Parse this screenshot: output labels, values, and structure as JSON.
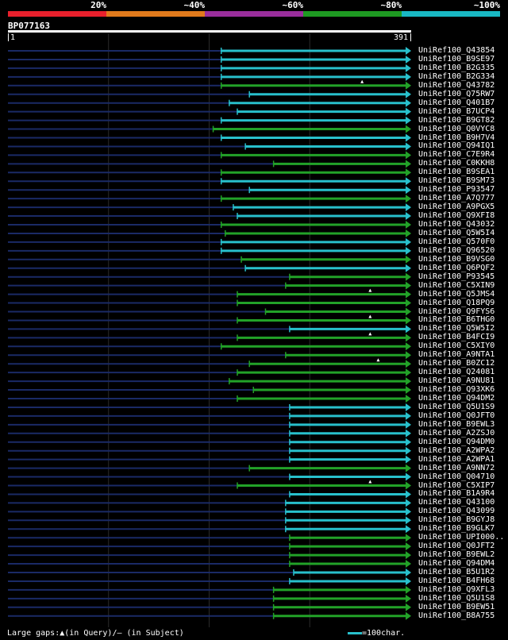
{
  "legend": {
    "labels": [
      "20%",
      "~40%",
      "~60%",
      "~80%",
      "~100%"
    ],
    "colors": [
      "#e8202c",
      "#e07a1c",
      "#9a2e9c",
      "#1e9a22",
      "#19b8c4"
    ]
  },
  "query": {
    "name": "BP077163",
    "start": "1",
    "end": "391"
  },
  "footer": {
    "gaps_text": "Large gaps:▲(in Query)/– (in Subject)",
    "scale_text": "=100char."
  },
  "hits": [
    {
      "id": "UniRef100_Q43854",
      "start": 0.53,
      "color": "cyan"
    },
    {
      "id": "UniRef100_B9SE97",
      "start": 0.53,
      "color": "cyan"
    },
    {
      "id": "UniRef100_B2G335",
      "start": 0.53,
      "color": "cyan"
    },
    {
      "id": "UniRef100_B2G334",
      "start": 0.53,
      "color": "cyan"
    },
    {
      "id": "UniRef100_Q43782",
      "start": 0.53,
      "color": "green",
      "gap": 0.88
    },
    {
      "id": "UniRef100_Q75RW7",
      "start": 0.6,
      "color": "cyan"
    },
    {
      "id": "UniRef100_Q401B7",
      "start": 0.55,
      "color": "cyan"
    },
    {
      "id": "UniRef100_B7UCP4",
      "start": 0.57,
      "color": "cyan"
    },
    {
      "id": "UniRef100_B9GT82",
      "start": 0.53,
      "color": "cyan"
    },
    {
      "id": "UniRef100_Q0VYC8",
      "start": 0.51,
      "color": "green"
    },
    {
      "id": "UniRef100_B9H7V4",
      "start": 0.53,
      "color": "cyan"
    },
    {
      "id": "UniRef100_Q94IQ1",
      "start": 0.59,
      "color": "cyan"
    },
    {
      "id": "UniRef100_C7E9R4",
      "start": 0.53,
      "color": "green"
    },
    {
      "id": "UniRef100_C0KKH8",
      "start": 0.66,
      "color": "green"
    },
    {
      "id": "UniRef100_B9SEA1",
      "start": 0.53,
      "color": "green"
    },
    {
      "id": "UniRef100_B9SM73",
      "start": 0.53,
      "color": "cyan"
    },
    {
      "id": "UniRef100_P93547",
      "start": 0.6,
      "color": "cyan"
    },
    {
      "id": "UniRef100_A7Q777",
      "start": 0.53,
      "color": "green"
    },
    {
      "id": "UniRef100_A9PGX5",
      "start": 0.56,
      "color": "cyan"
    },
    {
      "id": "UniRef100_Q9XFI8",
      "start": 0.57,
      "color": "cyan"
    },
    {
      "id": "UniRef100_Q43032",
      "start": 0.53,
      "color": "green"
    },
    {
      "id": "UniRef100_Q5W5I4",
      "start": 0.54,
      "color": "green"
    },
    {
      "id": "UniRef100_Q570F0",
      "start": 0.53,
      "color": "cyan"
    },
    {
      "id": "UniRef100_Q96520",
      "start": 0.53,
      "color": "cyan"
    },
    {
      "id": "UniRef100_B9VSG0",
      "start": 0.58,
      "color": "green"
    },
    {
      "id": "UniRef100_Q6PQF2",
      "start": 0.59,
      "color": "cyan"
    },
    {
      "id": "UniRef100_P93545",
      "start": 0.7,
      "color": "green"
    },
    {
      "id": "UniRef100_C5XIN9",
      "start": 0.69,
      "color": "green"
    },
    {
      "id": "UniRef100_Q5JMS4",
      "start": 0.57,
      "color": "green",
      "gap": 0.9
    },
    {
      "id": "UniRef100_Q18PQ9",
      "start": 0.57,
      "color": "green"
    },
    {
      "id": "UniRef100_Q9FYS6",
      "start": 0.64,
      "color": "green"
    },
    {
      "id": "UniRef100_B6THG0",
      "start": 0.57,
      "color": "green",
      "gap": 0.9
    },
    {
      "id": "UniRef100_Q5W5I2",
      "start": 0.7,
      "color": "cyan"
    },
    {
      "id": "UniRef100_B4FCI9",
      "start": 0.57,
      "color": "green",
      "gap": 0.9
    },
    {
      "id": "UniRef100_C5XIY0",
      "start": 0.53,
      "color": "green"
    },
    {
      "id": "UniRef100_A9NTA1",
      "start": 0.69,
      "color": "green"
    },
    {
      "id": "UniRef100_B0ZC12",
      "start": 0.6,
      "color": "green",
      "gap": 0.92
    },
    {
      "id": "UniRef100_Q24081",
      "start": 0.57,
      "color": "green"
    },
    {
      "id": "UniRef100_A9NU81",
      "start": 0.55,
      "color": "green"
    },
    {
      "id": "UniRef100_Q93XK6",
      "start": 0.61,
      "color": "green"
    },
    {
      "id": "UniRef100_Q94DM2",
      "start": 0.57,
      "color": "green"
    },
    {
      "id": "UniRef100_Q5U1S9",
      "start": 0.7,
      "color": "cyan"
    },
    {
      "id": "UniRef100_Q0JFT0",
      "start": 0.7,
      "color": "cyan"
    },
    {
      "id": "UniRef100_B9EWL3",
      "start": 0.7,
      "color": "cyan"
    },
    {
      "id": "UniRef100_A2ZSJ0",
      "start": 0.7,
      "color": "cyan"
    },
    {
      "id": "UniRef100_Q94DM0",
      "start": 0.7,
      "color": "cyan"
    },
    {
      "id": "UniRef100_A2WPA2",
      "start": 0.7,
      "color": "cyan"
    },
    {
      "id": "UniRef100_A2WPA1",
      "start": 0.7,
      "color": "cyan"
    },
    {
      "id": "UniRef100_A9NN72",
      "start": 0.6,
      "color": "green"
    },
    {
      "id": "UniRef100_Q04710",
      "start": 0.7,
      "color": "cyan"
    },
    {
      "id": "UniRef100_C5XIP7",
      "start": 0.57,
      "color": "green",
      "gap": 0.9
    },
    {
      "id": "UniRef100_B1A9R4",
      "start": 0.7,
      "color": "cyan"
    },
    {
      "id": "UniRef100_Q43100",
      "start": 0.69,
      "color": "cyan"
    },
    {
      "id": "UniRef100_Q43099",
      "start": 0.69,
      "color": "cyan"
    },
    {
      "id": "UniRef100_B9GYJ8",
      "start": 0.69,
      "color": "cyan"
    },
    {
      "id": "UniRef100_B9GLK7",
      "start": 0.69,
      "color": "cyan"
    },
    {
      "id": "UniRef100_UPI000..",
      "start": 0.7,
      "color": "green"
    },
    {
      "id": "UniRef100_Q0JFT2",
      "start": 0.7,
      "color": "green"
    },
    {
      "id": "UniRef100_B9EWL2",
      "start": 0.7,
      "color": "green"
    },
    {
      "id": "UniRef100_Q94DM4",
      "start": 0.7,
      "color": "green"
    },
    {
      "id": "UniRef100_B5U1R2",
      "start": 0.71,
      "color": "cyan"
    },
    {
      "id": "UniRef100_B4FH68",
      "start": 0.7,
      "color": "cyan"
    },
    {
      "id": "UniRef100_Q9XFL3",
      "start": 0.66,
      "color": "green"
    },
    {
      "id": "UniRef100_Q5U1S8",
      "start": 0.66,
      "color": "green"
    },
    {
      "id": "UniRef100_B9EW51",
      "start": 0.66,
      "color": "green"
    },
    {
      "id": "UniRef100_B8A755",
      "start": 0.66,
      "color": "green"
    }
  ]
}
